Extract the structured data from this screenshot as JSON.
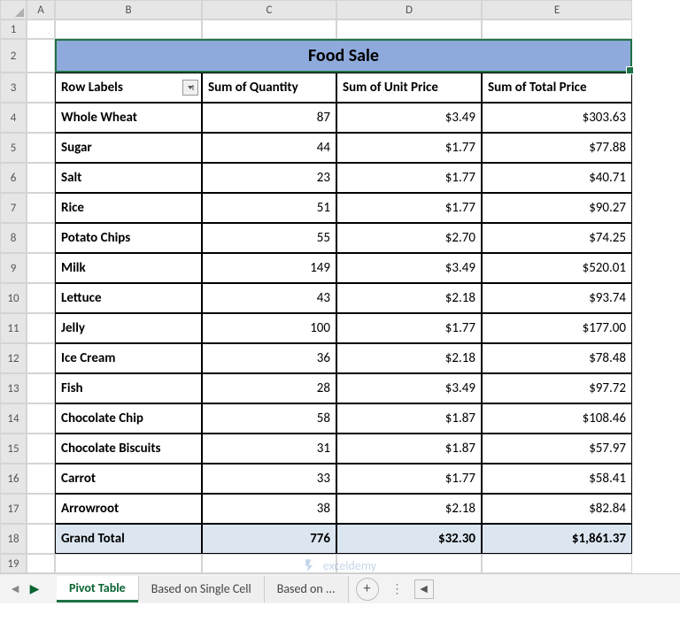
{
  "columns": [
    "A",
    "B",
    "C",
    "D",
    "E"
  ],
  "row_numbers": [
    "1",
    "2",
    "3",
    "4",
    "5",
    "6",
    "7",
    "8",
    "9",
    "10",
    "11",
    "12",
    "13",
    "14",
    "15",
    "16",
    "17",
    "18",
    "19"
  ],
  "title": "Food Sale",
  "headers": {
    "row_labels": "Row Labels",
    "qty": "Sum of Quantity",
    "unit": "Sum of Unit Price",
    "total": "Sum of Total Price"
  },
  "rows": [
    {
      "label": "Whole Wheat",
      "qty": "87",
      "unit": "$3.49",
      "total": "$303.63"
    },
    {
      "label": "Sugar",
      "qty": "44",
      "unit": "$1.77",
      "total": "$77.88"
    },
    {
      "label": "Salt",
      "qty": "23",
      "unit": "$1.77",
      "total": "$40.71"
    },
    {
      "label": "Rice",
      "qty": "51",
      "unit": "$1.77",
      "total": "$90.27"
    },
    {
      "label": "Potato Chips",
      "qty": "55",
      "unit": "$2.70",
      "total": "$74.25"
    },
    {
      "label": "Milk",
      "qty": "149",
      "unit": "$3.49",
      "total": "$520.01"
    },
    {
      "label": "Lettuce",
      "qty": "43",
      "unit": "$2.18",
      "total": "$93.74"
    },
    {
      "label": "Jelly",
      "qty": "100",
      "unit": "$1.77",
      "total": "$177.00"
    },
    {
      "label": "Ice Cream",
      "qty": "36",
      "unit": "$2.18",
      "total": "$78.48"
    },
    {
      "label": "Fish",
      "qty": "28",
      "unit": "$3.49",
      "total": "$97.72"
    },
    {
      "label": "Chocolate Chip",
      "qty": "58",
      "unit": "$1.87",
      "total": "$108.46"
    },
    {
      "label": "Chocolate Biscuits",
      "qty": "31",
      "unit": "$1.87",
      "total": "$57.97"
    },
    {
      "label": "Carrot",
      "qty": "33",
      "unit": "$1.77",
      "total": "$58.41"
    },
    {
      "label": "Arrowroot",
      "qty": "38",
      "unit": "$2.18",
      "total": "$82.84"
    }
  ],
  "grand_total": {
    "label": "Grand Total",
    "qty": "776",
    "unit": "$32.30",
    "total": "$1,861.37"
  },
  "tabs": {
    "active": "Pivot Table",
    "t2": "Based on Single Cell",
    "t3": "Based on ..."
  },
  "watermark": "exceldemy"
}
